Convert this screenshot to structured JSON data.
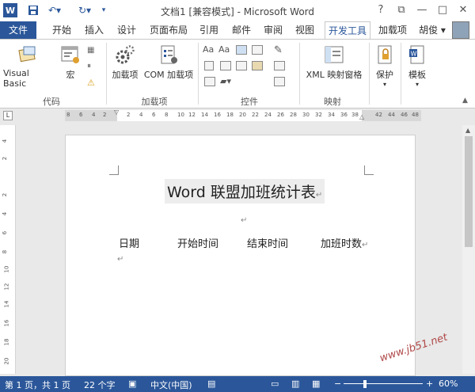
{
  "qat": {
    "word_icon": "word-icon",
    "save_icon": "save-icon",
    "undo_icon": "undo-icon",
    "redo_icon": "redo-icon",
    "more_icon": "chevron-down-icon"
  },
  "window": {
    "title": "文档1 [兼容模式] - Microsoft Word",
    "help": "?",
    "restore": "⧉",
    "minimize": "—",
    "maximize": "□",
    "close": "✕"
  },
  "tabs": {
    "file": "文件",
    "home": "开始",
    "insert": "插入",
    "design": "设计",
    "layout": "页面布局",
    "references": "引用",
    "mailings": "邮件",
    "review": "审阅",
    "view": "视图",
    "developer": "开发工具",
    "addins": "加载项",
    "user": "胡俊"
  },
  "ribbon": {
    "code": {
      "visual_basic": "Visual Basic",
      "macros": "宏",
      "group": "代码"
    },
    "addins": {
      "addins": "加载项",
      "com_addins": "COM 加载项",
      "group": "加载项"
    },
    "controls": {
      "group": "控件"
    },
    "mapping": {
      "xml_pane": "XML 映射窗格",
      "group": "映射"
    },
    "protect": {
      "protect": "保护"
    },
    "templates": {
      "template": "模板"
    }
  },
  "hruler": [
    "8",
    "6",
    "4",
    "2",
    "2",
    "4",
    "6",
    "8",
    "10",
    "12",
    "14",
    "16",
    "18",
    "20",
    "22",
    "24",
    "26",
    "28",
    "30",
    "32",
    "34",
    "36",
    "38",
    "42",
    "44",
    "46",
    "48"
  ],
  "vruler": [
    "4",
    "2",
    "2",
    "4",
    "6",
    "8",
    "10",
    "12",
    "14",
    "16",
    "18",
    "20"
  ],
  "document": {
    "heading": "Word 联盟加班统计表",
    "para_mark": "↵",
    "columns": [
      "日期",
      "开始时间",
      "结束时间",
      "加班时数"
    ]
  },
  "status": {
    "page": "第 1 页，共 1 页",
    "words": "22 个字",
    "language": "中文(中国)",
    "zoom": "60%",
    "zoom_minus": "−",
    "zoom_plus": "+"
  },
  "watermark": "www.jb51.net"
}
